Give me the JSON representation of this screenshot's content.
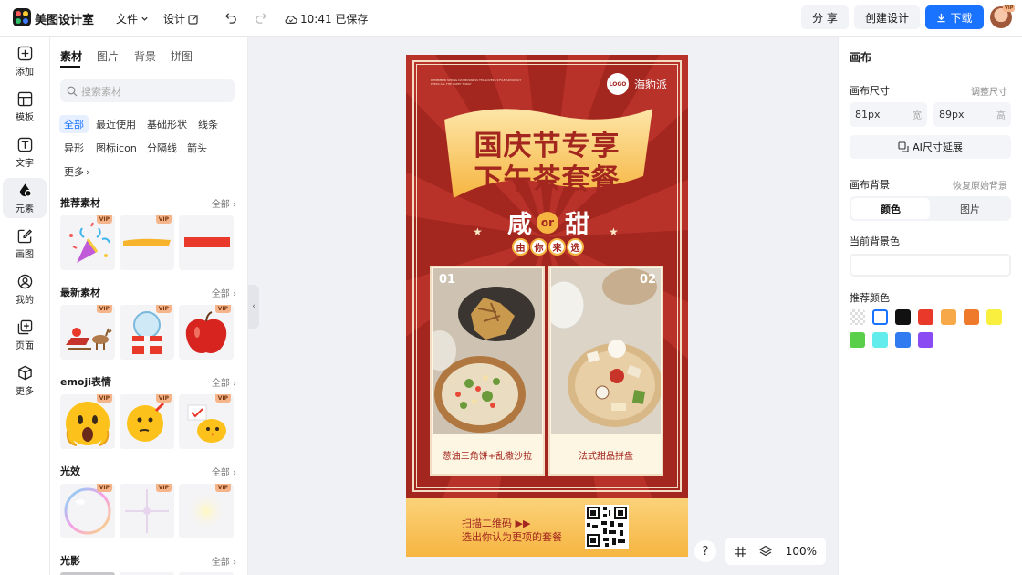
{
  "topbar": {
    "app_name": "美图设计室",
    "menu_file": "文件",
    "menu_design": "设计",
    "save_status": "10:41 已保存",
    "share_label": "分 享",
    "create_label": "创建设计",
    "download_label": "下载",
    "avatar_badge": "VIP",
    "logo_colors": [
      "#ff5a5a",
      "#ffcc33",
      "#2fc26b",
      "#3d7bff"
    ]
  },
  "rail": {
    "items": [
      {
        "label": "添加",
        "icon": "plus-square-icon"
      },
      {
        "label": "模板",
        "icon": "template-icon"
      },
      {
        "label": "文字",
        "icon": "text-icon"
      },
      {
        "label": "元素",
        "icon": "shapes-icon"
      },
      {
        "label": "画图",
        "icon": "draw-icon"
      },
      {
        "label": "我的",
        "icon": "user-icon"
      },
      {
        "label": "页面",
        "icon": "page-add-icon"
      },
      {
        "label": "更多",
        "icon": "cube-icon"
      }
    ],
    "active_index": 3
  },
  "panel": {
    "tabs": [
      "素材",
      "图片",
      "背景",
      "拼图"
    ],
    "search_placeholder": "搜索素材",
    "chips": [
      "全部",
      "最近使用",
      "基础形状",
      "线条",
      "异形",
      "图标icon",
      "分隔线",
      "箭头",
      "更多"
    ],
    "sections": [
      {
        "title": "推荐素材",
        "all": "全部"
      },
      {
        "title": "最新素材",
        "all": "全部"
      },
      {
        "title": "emoji表情",
        "all": "全部"
      },
      {
        "title": "光效",
        "all": "全部"
      },
      {
        "title": "光影",
        "all": "全部"
      }
    ],
    "vip_label": "VIP"
  },
  "poster": {
    "small_text": "REMEMBER SPRING DAY BUSINESS TEA LOVERS STYLE ADVOCACY PRESS ALL THE HAPPY TODAY",
    "logo_text": "LOGO",
    "brand": "海豹派",
    "title_line1": "国庆节专享",
    "title_line2": "下午茶套餐",
    "salty": "咸",
    "or": "or",
    "sweet": "甜",
    "choose": [
      "由",
      "你",
      "来",
      "选"
    ],
    "items": [
      {
        "num": "01",
        "caption": "葱油三角饼+乱撒沙拉"
      },
      {
        "num": "02",
        "caption": "法式甜品拼盘"
      }
    ],
    "scan_line1": "扫描二维码 ▶▶",
    "scan_line2": "选出你认为更项的套餐",
    "colors": {
      "red": "#a3261f",
      "gold": "#f6b540",
      "cream": "#fdf6e2"
    }
  },
  "bottom": {
    "help": "?",
    "zoom": "100%"
  },
  "right": {
    "title": "画布",
    "size_label": "画布尺寸",
    "adjust_size": "调整尺寸",
    "width_value": "81px",
    "width_unit": "宽",
    "height_value": "89px",
    "height_unit": "高",
    "ai_extend": "AI尺寸延展",
    "bg_label": "画布背景",
    "restore_bg": "恢复原始背景",
    "seg_color": "颜色",
    "seg_image": "图片",
    "current_bg": "当前背景色",
    "recommended": "推荐颜色",
    "swatches": [
      "transparent",
      "#ffffff",
      "#111111",
      "#e8392b",
      "#f7a94a",
      "#f07a2b",
      "#f8ef3f",
      "#5ad04a",
      "#62ecec",
      "#2f7bef",
      "#8a4cf2"
    ]
  }
}
